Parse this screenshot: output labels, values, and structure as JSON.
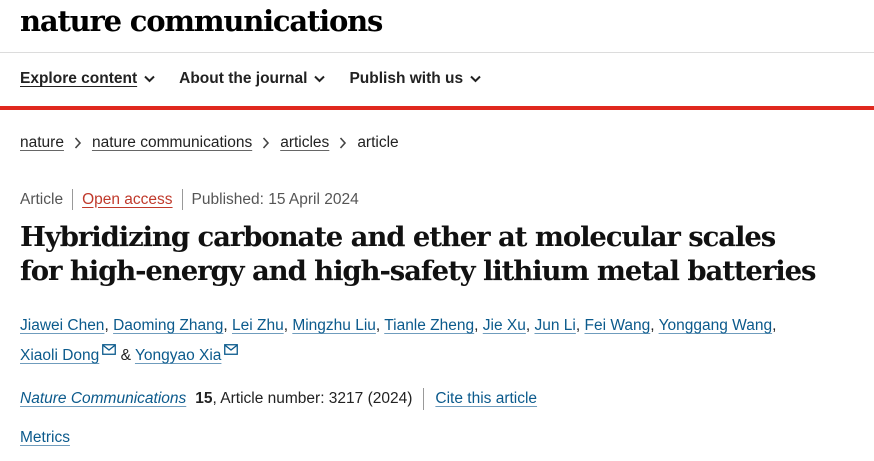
{
  "header": {
    "logo": "nature communications"
  },
  "nav": {
    "items": [
      {
        "label": "Explore content"
      },
      {
        "label": "About the journal"
      },
      {
        "label": "Publish with us"
      }
    ]
  },
  "breadcrumb": {
    "items": [
      "nature",
      "nature communications",
      "articles"
    ],
    "current": "article"
  },
  "article": {
    "type": "Article",
    "access": "Open access",
    "published": "Published: 15 April 2024",
    "title_line1": "Hybridizing carbonate and ether at molecular scales",
    "title_line2": "for high-energy and high-safety lithium metal batteries",
    "authors": [
      "Jiawei Chen",
      "Daoming Zhang",
      "Lei Zhu",
      "Mingzhu Liu",
      "Tianle Zheng",
      "Jie Xu",
      "Jun Li",
      "Fei Wang",
      "Yonggang Wang",
      "Xiaoli Dong",
      "Yongyao Xia"
    ],
    "author_separator": ", ",
    "author_and": " & ",
    "journal": "Nature Communications",
    "volume": "15",
    "article_number": ", Article number: 3217 (2024)",
    "cite_label": "Cite this article",
    "metrics_label": "Metrics"
  },
  "colors": {
    "accent_red": "#e0281e",
    "link_blue": "#0b5a8c",
    "open_access": "#c0392b"
  }
}
